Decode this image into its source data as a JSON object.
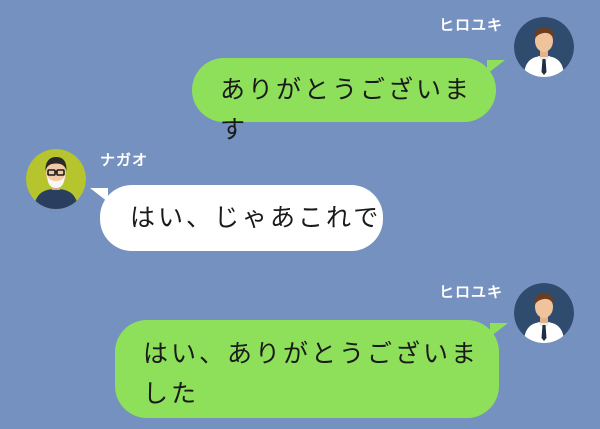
{
  "colors": {
    "background": "#7591c0",
    "outgoing_bubble": "#8ee05a",
    "incoming_bubble": "#ffffff",
    "hiroyuki_avatar_bg": "#2f4b6e",
    "nagao_avatar_bg": "#b6c42e"
  },
  "messages": [
    {
      "sender": "ヒロユキ",
      "side": "right",
      "avatar_icon": "man-with-tie-icon",
      "text": "ありがとうございます"
    },
    {
      "sender": "ナガオ",
      "side": "left",
      "avatar_icon": "man-with-glasses-beard-icon",
      "text": "はい、じゃあこれで"
    },
    {
      "sender": "ヒロユキ",
      "side": "right",
      "avatar_icon": "man-with-tie-icon",
      "text": "はい、ありがとうございました"
    }
  ]
}
